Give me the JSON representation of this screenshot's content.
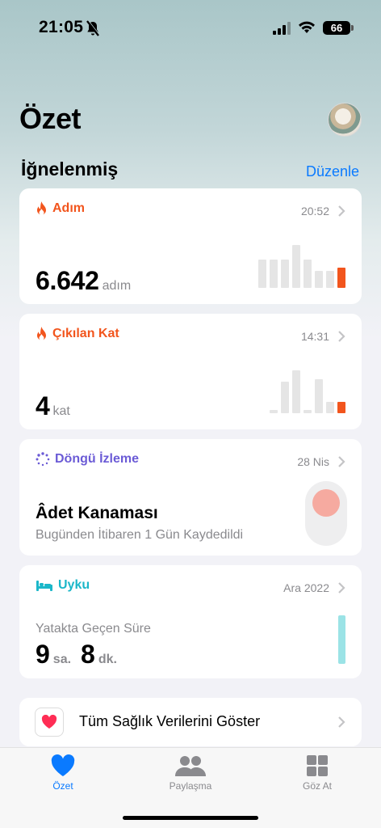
{
  "status": {
    "time": "21:05",
    "battery": "66"
  },
  "header": {
    "title": "Özet"
  },
  "pinned": {
    "title": "İğnelenmiş",
    "edit_label": "Düzenle"
  },
  "cards": {
    "steps": {
      "title": "Adım",
      "time": "20:52",
      "value": "6.642",
      "unit": "adım",
      "bar_levels": [
        0.62,
        0.62,
        0.62,
        0.94,
        0.62,
        0.38,
        0.38,
        0.44
      ]
    },
    "floors": {
      "title": "Çıkılan Kat",
      "time": "14:31",
      "value": "4",
      "unit": "kat",
      "bar_levels": [
        0.08,
        0.69,
        0.94,
        0.08,
        0.75,
        0.25,
        0.25
      ]
    },
    "cycle": {
      "title": "Döngü İzleme",
      "date": "28 Nis",
      "status": "Âdet Kanaması",
      "detail": "Bugünden İtibaren 1 Gün Kaydedildi"
    },
    "sleep": {
      "title": "Uyku",
      "date": "Ara 2022",
      "label": "Yatakta Geçen Süre",
      "hours": "9",
      "hours_unit": "sa.",
      "minutes": "8",
      "minutes_unit": "dk."
    }
  },
  "all_data": {
    "label": "Tüm Sağlık Verilerini Göster"
  },
  "tabs": [
    {
      "label": "Özet",
      "icon": "heart-icon",
      "active": true
    },
    {
      "label": "Paylaşma",
      "icon": "people-icon",
      "active": false
    },
    {
      "label": "Göz At",
      "icon": "grid-icon",
      "active": false
    }
  ],
  "colors": {
    "accent": "#0a7aff",
    "activity": "#f2551d",
    "cycle": "#6b5bd6",
    "sleep": "#1bb7c9"
  }
}
